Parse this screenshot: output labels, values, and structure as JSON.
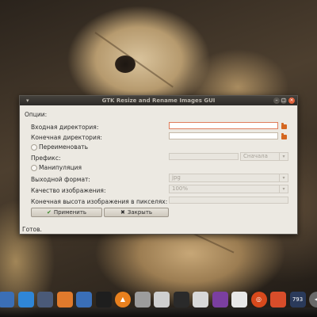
{
  "window": {
    "title": "GTK Resize and Rename Images GUI",
    "wm_icon": "menu-icon",
    "buttons": {
      "minimize": "–",
      "maximize": "□",
      "close": "×"
    }
  },
  "form": {
    "options_label": "Опции:",
    "input_dir_label": "Входная директория:",
    "input_dir_value": "",
    "output_dir_label": "Конечная директория:",
    "output_dir_value": "",
    "rename_label": "Переименовать",
    "prefix_label": "Префикс:",
    "prefix_value": "",
    "prefix_combo_value": "Сначала",
    "manipulation_label": "Манипуляция",
    "format_label": "Выходной формат:",
    "format_value": "jpg",
    "quality_label": "Качество изображения:",
    "quality_value": "100%",
    "height_label": "Конечная высота изображения в пикселях:",
    "height_value": ""
  },
  "buttons": {
    "apply_label": "Применить",
    "close_label": "Закрыть",
    "apply_icon": "check-icon",
    "close_icon": "close-icon"
  },
  "status": {
    "text": "Готов."
  },
  "dock": {
    "items": [
      {
        "name": "finder-icon",
        "color": "#3b6fb6",
        "glyph": ""
      },
      {
        "name": "browser-icon",
        "color": "#2f86d6",
        "glyph": ""
      },
      {
        "name": "virtualbox-icon",
        "color": "#4a5a78",
        "glyph": ""
      },
      {
        "name": "firefox-icon",
        "color": "#e07a2c",
        "glyph": ""
      },
      {
        "name": "thunderbird-icon",
        "color": "#3a6fb8",
        "glyph": ""
      },
      {
        "name": "clapper-icon",
        "color": "#1e1e1e",
        "glyph": ""
      },
      {
        "name": "vlc-icon",
        "color": "#e8801e",
        "glyph": "▲"
      },
      {
        "name": "chat-icon",
        "color": "#9c9c9c",
        "glyph": ""
      },
      {
        "name": "disk-icon",
        "color": "#cfcfcf",
        "glyph": ""
      },
      {
        "name": "terminal-icon",
        "color": "#2a2a2a",
        "glyph": ""
      },
      {
        "name": "screen-icon",
        "color": "#d8d8d8",
        "glyph": ""
      },
      {
        "name": "emerald-icon",
        "color": "#7b3fa0",
        "glyph": ""
      },
      {
        "name": "media-icon",
        "color": "#e8e8e8",
        "glyph": ""
      },
      {
        "name": "ubuntu-icon",
        "color": "#d8491c",
        "glyph": "◎"
      },
      {
        "name": "puzzle-icon",
        "color": "#d84d2a",
        "glyph": ""
      },
      {
        "name": "calendar-icon",
        "color": "#2a3a5a",
        "glyph": ""
      },
      {
        "name": "speaker-icon",
        "color": "#6a6a6a",
        "glyph": "◀"
      }
    ],
    "calendar_text": "793"
  },
  "colors": {
    "accent_focus": "#e07c5a",
    "folder": "#d4661f",
    "close_button": "#e0603a"
  }
}
